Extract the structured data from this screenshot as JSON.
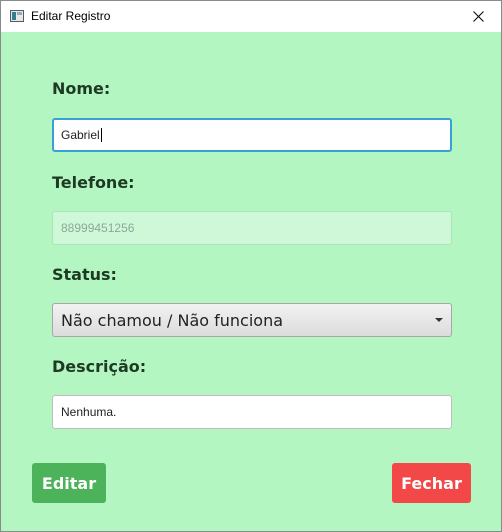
{
  "window": {
    "title": "Editar Registro"
  },
  "form": {
    "nome": {
      "label": "Nome:",
      "value": "Gabriel"
    },
    "telefone": {
      "label": "Telefone:",
      "value": "88999451256"
    },
    "status": {
      "label": "Status:",
      "selected": "Não chamou / Não funciona"
    },
    "descricao": {
      "label": "Descrição:",
      "value": "Nenhuma."
    }
  },
  "buttons": {
    "edit_label": "Editar",
    "close_label": "Fechar"
  },
  "colors": {
    "background": "#b3f6c2",
    "edit_button": "#4cb35a",
    "close_button": "#f24848",
    "focus_border": "#3aa0d8"
  },
  "icons": {
    "app": "app-window-icon",
    "close": "close-icon",
    "dropdown": "chevron-down-icon"
  }
}
